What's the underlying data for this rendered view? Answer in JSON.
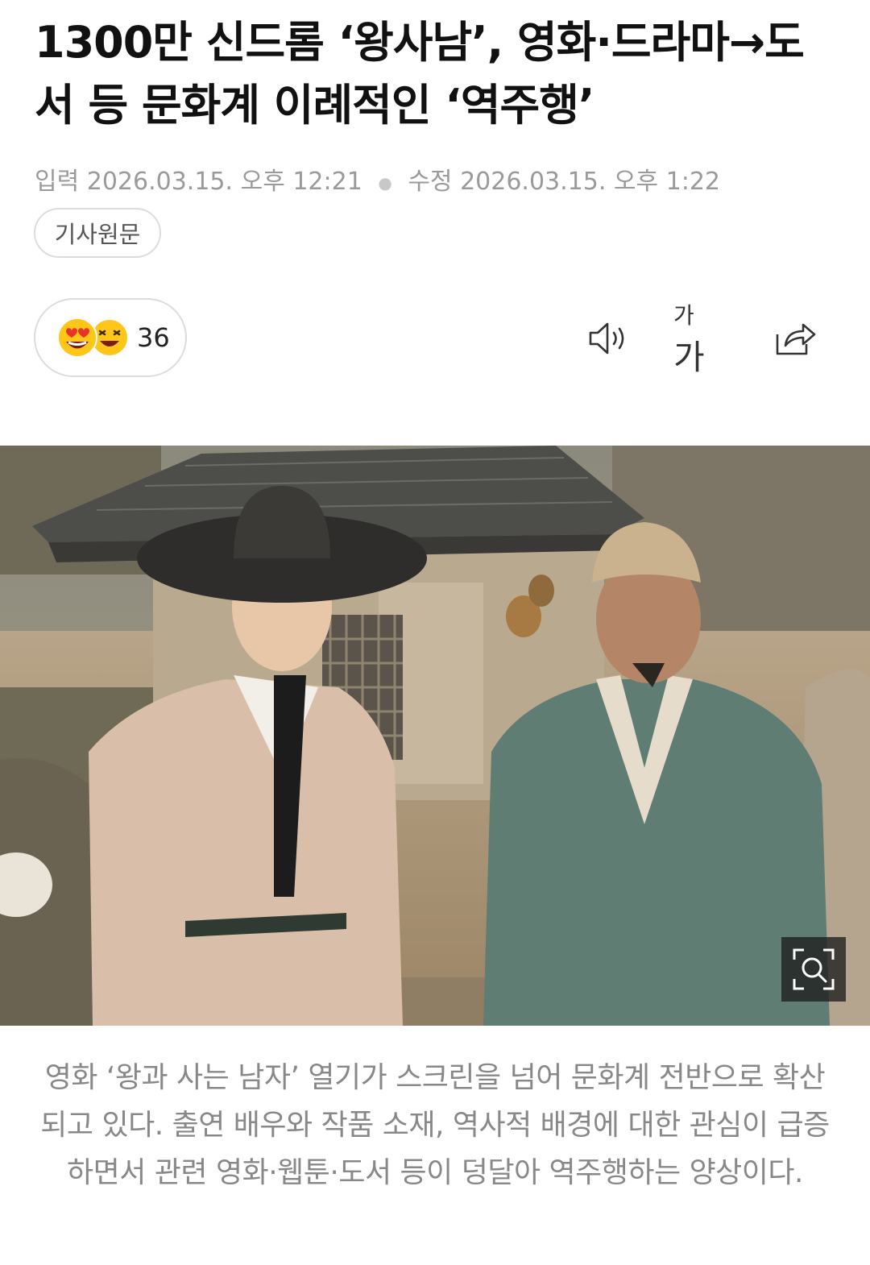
{
  "article": {
    "title": "1300만 신드롬 ‘왕사남’, 영화·드라마→도서 등 문화계 이례적인 ‘역주행’",
    "input_label": "입력",
    "input_time": "2026.03.15. 오후 12:21",
    "edit_label": "수정",
    "edit_time": "2026.03.15. 오후 1:22",
    "original_button": "기사원문"
  },
  "reactions": {
    "count": "36",
    "icons": [
      "heart-eyes-emoji-icon",
      "laughing-emoji-icon"
    ]
  },
  "toolbar": {
    "tts_icon": "speaker-icon",
    "font_small": "가",
    "font_large": "가",
    "share_icon": "share-icon"
  },
  "photo": {
    "zoom_icon": "zoom-search-icon"
  },
  "caption": "영화 ‘왕과 사는 남자’ 열기가 스크린을 넘어 문화계 전반으로 확산되고 있다. 출연 배우와 작품 소재, 역사적 배경에 대한 관심이 급증하면서 관련 영화·웹툰·도서 등이 덩달아 역주행하는 양상이다.",
  "colors": {
    "meta_text": "#9a9a9a",
    "caption_text": "#888888",
    "emoji_yellow": "#ffc61a",
    "emoji_red": "#e8332a"
  }
}
